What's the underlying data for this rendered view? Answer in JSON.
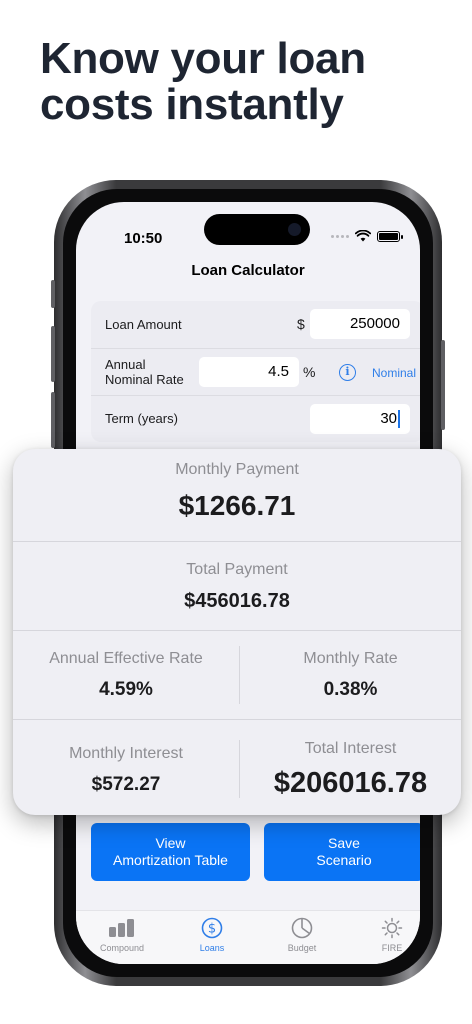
{
  "headline": {
    "line1": "Know your loan",
    "line2": "costs instantly"
  },
  "status_bar": {
    "time": "10:50"
  },
  "nav": {
    "title": "Loan Calculator"
  },
  "form": {
    "loan_amount": {
      "label": "Loan Amount",
      "currency": "$",
      "value": "250000"
    },
    "rate": {
      "label_line1": "Annual",
      "label_line2": "Nominal Rate",
      "value": "4.5",
      "unit": "%",
      "info_glyph": "i",
      "mode": "Nominal"
    },
    "term": {
      "label": "Term (years)",
      "value": "30"
    }
  },
  "results": {
    "monthly_payment": {
      "label": "Monthly Payment",
      "value": "$1266.71"
    },
    "total_payment": {
      "label": "Total Payment",
      "value": "$456016.78"
    },
    "annual_effective_rate": {
      "label": "Annual Effective Rate",
      "value": "4.59%"
    },
    "monthly_rate": {
      "label": "Monthly Rate",
      "value": "0.38%"
    },
    "monthly_interest": {
      "label": "Monthly Interest",
      "value": "$572.27"
    },
    "total_interest": {
      "label": "Total Interest",
      "value": "$206016.78"
    }
  },
  "buttons": {
    "amortization": {
      "line1": "View",
      "line2": "Amortization Table"
    },
    "save": {
      "line1": "Save",
      "line2": "Scenario"
    }
  },
  "tabs": [
    {
      "label": "Compound",
      "icon": "bar-chart-icon",
      "active": false
    },
    {
      "label": "Loans",
      "icon": "dollar-circle-icon",
      "active": true
    },
    {
      "label": "Budget",
      "icon": "pie-chart-icon",
      "active": false
    },
    {
      "label": "FIRE",
      "icon": "sun-icon",
      "active": false
    }
  ],
  "colors": {
    "accent": "#0a74f5",
    "link": "#2f7ee8",
    "background": "#f2f2f7",
    "headline": "#1e2532"
  }
}
